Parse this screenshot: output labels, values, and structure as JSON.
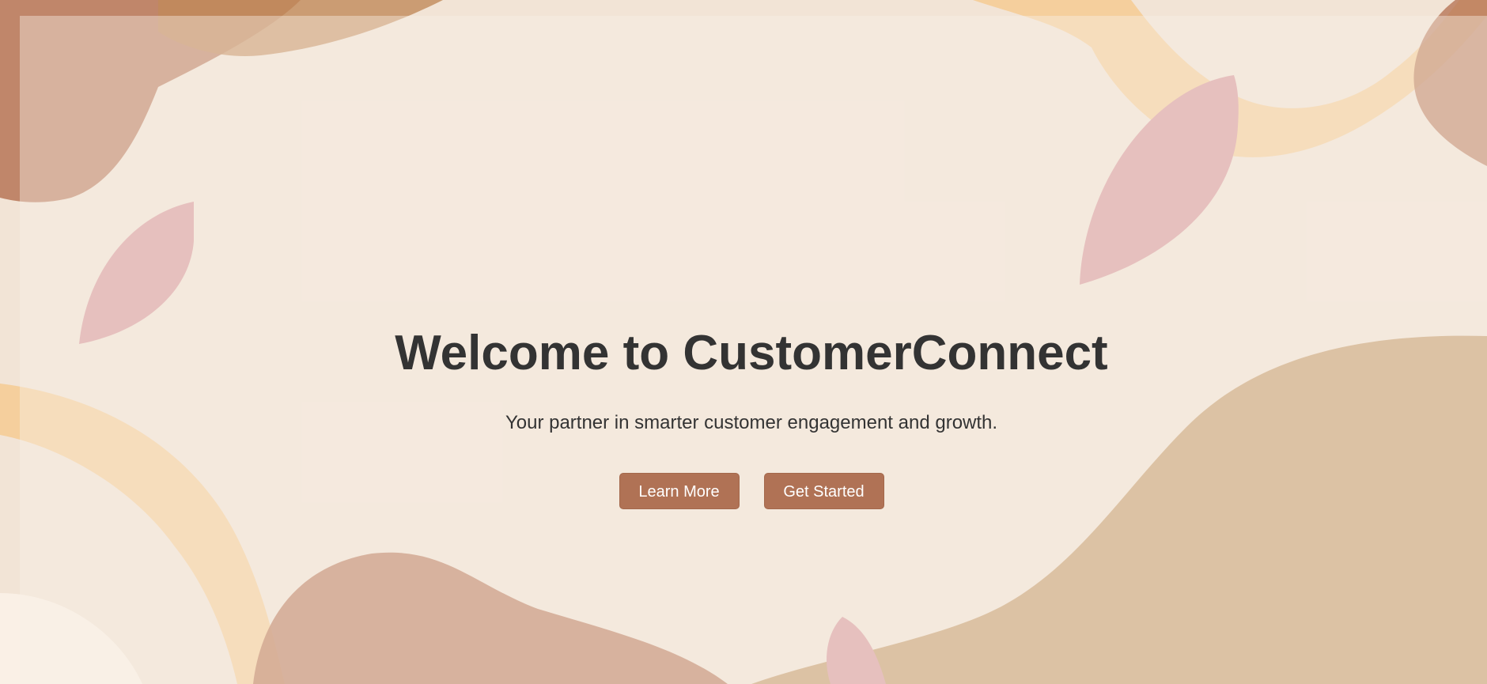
{
  "hero": {
    "title": "Welcome to CustomerConnect",
    "subtitle": "Your partner in smarter customer engagement and growth."
  },
  "actions": {
    "learn_more_label": "Learn More",
    "get_started_label": "Get Started"
  },
  "colors": {
    "background": "#f2e4d6",
    "accent_button": "#b07255",
    "text": "#333333",
    "leaf_pink": "#d99da0",
    "ribbon_orange": "#f5c98f",
    "blob_tan": "#c9a174",
    "blob_rust": "#b77557"
  }
}
